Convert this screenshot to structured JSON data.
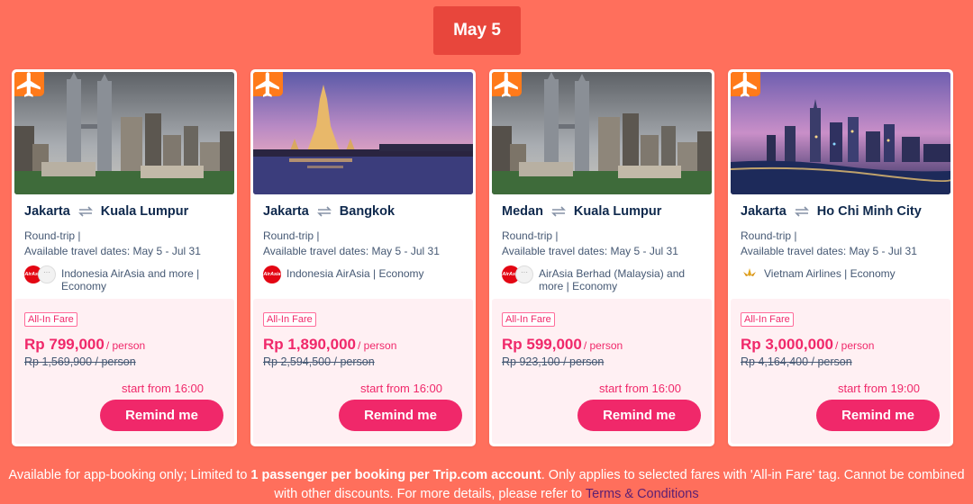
{
  "date_tab": "May 5",
  "cards": [
    {
      "origin": "Jakarta",
      "destination": "Kuala Lumpur",
      "trip_type": "Round-trip |",
      "travel_dates": "Available travel dates: May 5 - Jul 31",
      "airline_text": "Indonesia AirAsia and more | Economy",
      "airline_logo": "AirAsia",
      "fare_tag": "All-In Fare",
      "price": "Rp 799,000",
      "per": "/ person",
      "old_price": "Rp 1,569,900 / person",
      "start_time": "start from 16:00",
      "button": "Remind me",
      "image": "kuala-lumpur-skyline"
    },
    {
      "origin": "Jakarta",
      "destination": "Bangkok",
      "trip_type": "Round-trip |",
      "travel_dates": "Available travel dates: May 5 - Jul 31",
      "airline_text": "Indonesia AirAsia | Economy",
      "airline_logo": "AirAsia",
      "fare_tag": "All-In Fare",
      "price": "Rp 1,890,000",
      "per": "/ person",
      "old_price": "Rp 2,594,500 / person",
      "start_time": "start from 16:00",
      "button": "Remind me",
      "image": "bangkok-temple-dusk"
    },
    {
      "origin": "Medan",
      "destination": "Kuala Lumpur",
      "trip_type": "Round-trip |",
      "travel_dates": "Available travel dates: May 5 - Jul 31",
      "airline_text": "AirAsia Berhad (Malaysia) and more | Economy",
      "airline_logo": "AirAsia",
      "fare_tag": "All-In Fare",
      "price": "Rp 599,000",
      "per": "/ person",
      "old_price": "Rp 923,100 / person",
      "start_time": "start from 16:00",
      "button": "Remind me",
      "image": "kuala-lumpur-skyline"
    },
    {
      "origin": "Jakarta",
      "destination": "Ho Chi Minh City",
      "trip_type": "Round-trip |",
      "travel_dates": "Available travel dates: May 5 - Jul 31",
      "airline_text": "Vietnam Airlines | Economy",
      "airline_logo": "Vietnam Airlines",
      "fare_tag": "All-In Fare",
      "price": "Rp 3,000,000",
      "per": "/ person",
      "old_price": "Rp 4,164,400 / person",
      "start_time": "start from 19:00",
      "button": "Remind me",
      "image": "ho-chi-minh-city-night"
    }
  ],
  "footer": {
    "text_before": "Available for app-booking only; Limited to ",
    "bold": "1 passenger per booking per Trip.com account",
    "text_after": ". Only applies to selected fares with 'All-in Fare' tag. Cannot be combined with other discounts. For more details, please refer to ",
    "link": "Terms & Conditions"
  },
  "colors": {
    "background": "#ff6f5c",
    "date_tab": "#e8463c",
    "accent_pink": "#f0286a",
    "badge_orange": "#ff7a1a",
    "link": "#5b1f73"
  }
}
